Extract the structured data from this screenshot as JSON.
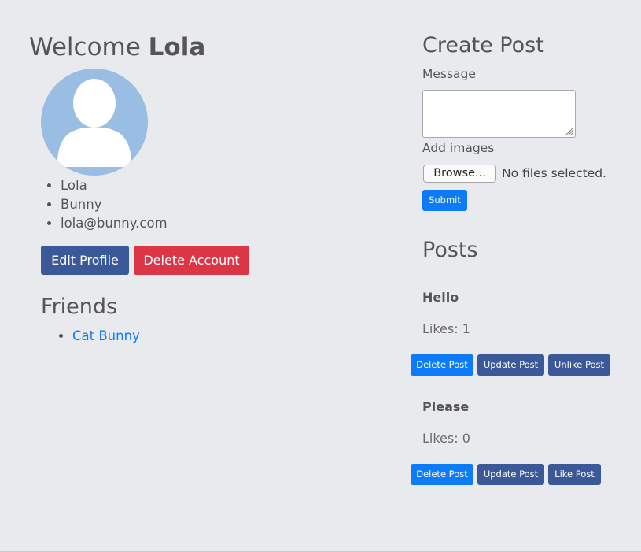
{
  "profile": {
    "welcome_prefix": "Welcome",
    "username": "Lola",
    "details": [
      "Lola",
      "Bunny",
      "lola@bunny.com"
    ],
    "edit_label": "Edit Profile",
    "delete_label": "Delete Account"
  },
  "friends": {
    "title": "Friends",
    "items": [
      "Cat Bunny"
    ]
  },
  "create_post": {
    "title": "Create Post",
    "message_label": "Message",
    "message_value": "",
    "images_label": "Add images",
    "browse_label": "Browse...",
    "file_status": "No files selected.",
    "submit_label": "Submit"
  },
  "posts": {
    "title": "Posts",
    "items": [
      {
        "title": "Hello",
        "likes": "Likes: 1",
        "delete_label": "Delete Post",
        "update_label": "Update Post",
        "like_toggle_label": "Unlike Post"
      },
      {
        "title": "Please",
        "likes": "Likes: 0",
        "delete_label": "Delete Post",
        "update_label": "Update Post",
        "like_toggle_label": "Like Post"
      }
    ]
  },
  "colors": {
    "background": "#e9eaee",
    "primary_navy": "#3b5998",
    "danger_red": "#dc3545",
    "link_blue": "#0d7bf7",
    "avatar_blue": "#99bde3"
  },
  "icons": {
    "avatar": "user-silhouette-icon"
  }
}
